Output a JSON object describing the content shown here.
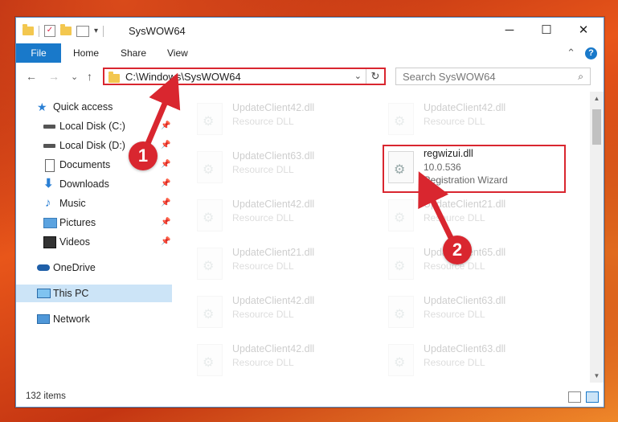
{
  "window": {
    "title": "SysWOW64"
  },
  "controls": {
    "minimize": "─",
    "maximize": "☐",
    "close": "✕"
  },
  "ribbon": {
    "file": "File",
    "tabs": [
      "Home",
      "Share",
      "View"
    ],
    "collapse": "⌃",
    "help": "?"
  },
  "nav": {
    "back": "←",
    "forward": "→",
    "recent": "⌄",
    "up": "↑"
  },
  "address": {
    "path": "C:\\Windows\\SysWOW64",
    "dropdown": "⌄",
    "refresh": "↻"
  },
  "search": {
    "placeholder": "Search SysWOW64",
    "icon": "⌕"
  },
  "sidebar": {
    "items": [
      {
        "label": "Quick access",
        "icon": "star-icon",
        "pinned": false
      },
      {
        "label": "Local Disk (C:)",
        "icon": "drive-icon",
        "pinned": true
      },
      {
        "label": "Local Disk (D:)",
        "icon": "drive-icon",
        "pinned": true
      },
      {
        "label": "Documents",
        "icon": "documents-icon",
        "pinned": true
      },
      {
        "label": "Downloads",
        "icon": "download-icon",
        "pinned": true
      },
      {
        "label": "Music",
        "icon": "music-icon",
        "pinned": true
      },
      {
        "label": "Pictures",
        "icon": "pictures-icon",
        "pinned": true
      },
      {
        "label": "Videos",
        "icon": "videos-icon",
        "pinned": true
      },
      {
        "label": "OneDrive",
        "icon": "cloud-icon",
        "pinned": false
      },
      {
        "label": "This PC",
        "icon": "computer-icon",
        "pinned": false,
        "selected": true
      },
      {
        "label": "Network",
        "icon": "network-icon",
        "pinned": false
      }
    ]
  },
  "files": {
    "left": [
      {
        "name": "UpdateClient42.dll",
        "type": "Resource DLL"
      },
      {
        "name": "UpdateClient63.dll",
        "type": "Resource DLL"
      },
      {
        "name": "UpdateClient42.dll",
        "type": "Resource DLL"
      },
      {
        "name": "UpdateClient21.dll",
        "type": "Resource DLL"
      },
      {
        "name": "UpdateClient42.dll",
        "type": "Resource DLL"
      },
      {
        "name": "UpdateClient42.dll",
        "type": "Resource DLL"
      }
    ],
    "right": [
      {
        "name": "UpdateClient42.dll",
        "type": "Resource DLL"
      },
      {
        "name": "regwizui.dll",
        "version": "10.0.536",
        "type": "Registration Wizard",
        "highlighted": true
      },
      {
        "name": "UpdateClient21.dll",
        "type": "Resource DLL"
      },
      {
        "name": "UpdateClient65.dll",
        "type": "Resource DLL"
      },
      {
        "name": "UpdateClient63.dll",
        "type": "Resource DLL"
      },
      {
        "name": "UpdateClient63.dll",
        "type": "Resource DLL"
      }
    ]
  },
  "status": {
    "item_count": "132 items"
  },
  "callouts": [
    "1",
    "2"
  ],
  "colors": {
    "accent": "#1979ca",
    "highlight": "#d9262f",
    "selected": "#cce4f7"
  }
}
